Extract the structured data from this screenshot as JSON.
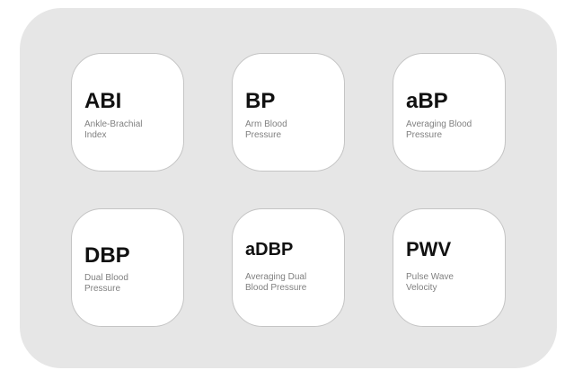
{
  "tiles": [
    {
      "abbr": "ABI",
      "desc_line1": "Ankle-Brachial",
      "desc_line2": "Index"
    },
    {
      "abbr": "BP",
      "desc_line1": "Arm Blood",
      "desc_line2": "Pressure"
    },
    {
      "abbr": "aBP",
      "desc_line1": "Averaging Blood",
      "desc_line2": "Pressure"
    },
    {
      "abbr": "DBP",
      "desc_line1": "Dual Blood",
      "desc_line2": "Pressure"
    },
    {
      "abbr": "aDBP",
      "desc_line1": "Averaging Dual",
      "desc_line2": "Blood Pressure"
    },
    {
      "abbr": "PWV",
      "desc_line1": "Pulse Wave",
      "desc_line2": "Velocity"
    }
  ]
}
